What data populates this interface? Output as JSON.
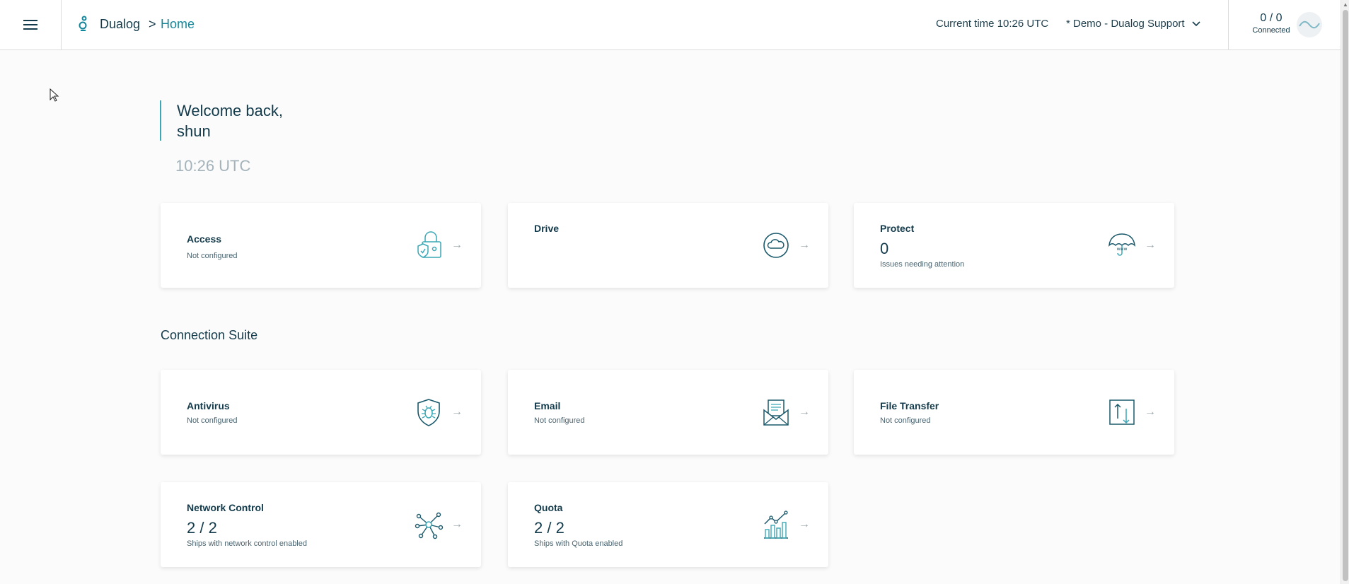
{
  "header": {
    "brand": "Dualog",
    "breadcrumb_sep": ">",
    "breadcrumb_current": "Home",
    "current_time": "Current time 10:26 UTC",
    "tenant": "* Demo - Dualog Support",
    "connected_count": "0 / 0",
    "connected_label": "Connected"
  },
  "welcome": {
    "line1": "Welcome back,",
    "line2": "shun",
    "time": "10:26 UTC"
  },
  "top_cards": [
    {
      "title": "Access",
      "subtitle": "Not configured",
      "icon": "lock-shield-icon"
    },
    {
      "title": "Drive",
      "subtitle": "",
      "icon": "cloud-icon"
    },
    {
      "title": "Protect",
      "value": "0",
      "subtitle": "Issues needing attention",
      "icon": "umbrella-www-icon"
    }
  ],
  "section": {
    "title": "Connection Suite"
  },
  "suite_cards": [
    {
      "title": "Antivirus",
      "subtitle": "Not configured",
      "icon": "bug-shield-icon"
    },
    {
      "title": "Email",
      "subtitle": "Not configured",
      "icon": "envelope-letter-icon"
    },
    {
      "title": "File Transfer",
      "subtitle": "Not configured",
      "icon": "transfer-arrows-icon"
    },
    {
      "title": "Network Control",
      "value": "2 / 2",
      "subtitle": "Ships with network control enabled",
      "icon": "network-nodes-icon"
    },
    {
      "title": "Quota",
      "value": "2 / 2",
      "subtitle": "Ships with Quota enabled",
      "icon": "bar-chart-trend-icon"
    }
  ],
  "arrow": "→",
  "colors": {
    "accent": "#14869a",
    "text": "#133b4c",
    "muted": "#a4b3ba"
  }
}
